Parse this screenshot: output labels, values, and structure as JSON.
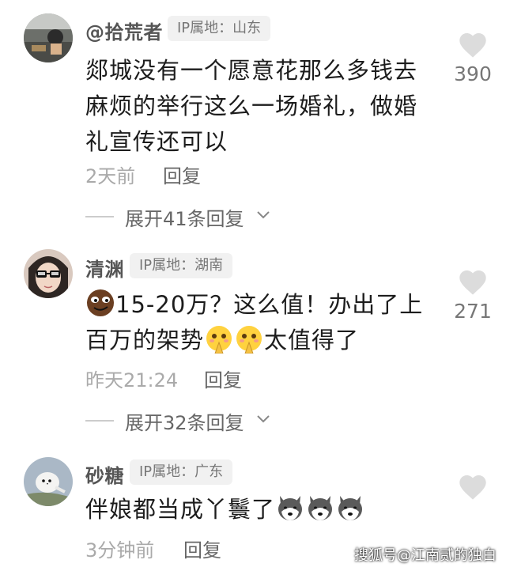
{
  "comments": [
    {
      "username": "@拾荒者",
      "ip_label": "IP属地：山东",
      "text": "郯城没有一个愿意花那么多钱去麻烦的举行这么一场婚礼，做婚礼宣传还可以",
      "likes": "390",
      "time": "2天前",
      "reply_label": "回复",
      "expand_label": "展开41条回复"
    },
    {
      "username": "清渊",
      "ip_label": "IP属地：湖南",
      "text_before": "15-20万？这么值！办出了上百万的架势",
      "text_after": "太值得了",
      "likes": "271",
      "time": "昨天21:24",
      "reply_label": "回复",
      "expand_label": "展开32条回复"
    },
    {
      "username": "砂糖",
      "ip_label": "IP属地：广东",
      "text": "伴娘都当成丫鬟了",
      "time": "3分钟前",
      "reply_label": "回复"
    }
  ],
  "icons": {
    "like": "heart-icon",
    "expand": "chevron-down-icon",
    "emoji_face": "smirk-face-emoji",
    "emoji_pray": "praying-face-emoji",
    "emoji_dog": "husky-dog-emoji"
  },
  "watermark": "搜狐号@江南贰的独白"
}
